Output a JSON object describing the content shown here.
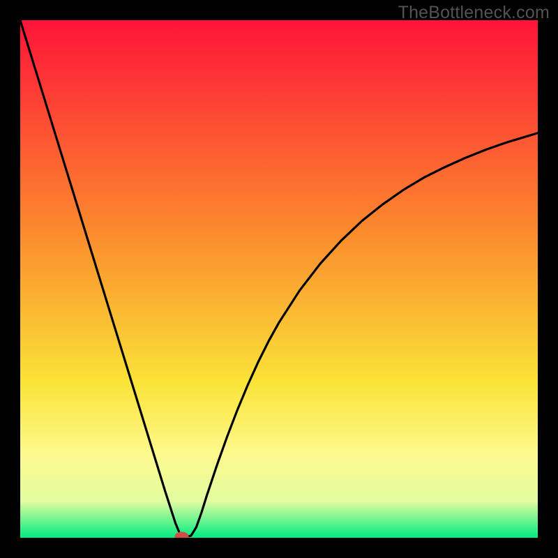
{
  "watermark": "TheBottleneck.com",
  "colors": {
    "frame": "#000000",
    "curve": "#000000",
    "marker_fill": "#d24e46",
    "marker_stroke": "#d24e46",
    "gradient_top": "#fe1438",
    "gradient_mid1": "#fb8e2d",
    "gradient_mid2": "#fae338",
    "gradient_band": "#fdfa8e",
    "gradient_light": "#e1fca0",
    "gradient_bot": "#00ec82"
  },
  "chart_data": {
    "type": "line",
    "title": "",
    "xlabel": "",
    "ylabel": "",
    "xlim": [
      0,
      100
    ],
    "ylim": [
      0,
      100
    ],
    "series": [
      {
        "name": "bottleneck-curve",
        "x": [
          0,
          2,
          4,
          6,
          8,
          10,
          12,
          14,
          16,
          18,
          20,
          22,
          24,
          26,
          28,
          30,
          31,
          32,
          33,
          34,
          35,
          36,
          38,
          40,
          42,
          44,
          46,
          48,
          50,
          54,
          58,
          62,
          66,
          70,
          74,
          78,
          82,
          86,
          90,
          94,
          98,
          100
        ],
        "y": [
          100,
          93.5,
          87,
          80.5,
          74,
          67.5,
          61,
          54.5,
          48,
          41.5,
          35,
          28.5,
          22,
          15.5,
          9,
          2.8,
          0.4,
          0.2,
          0.4,
          2.0,
          4.8,
          8.0,
          14.0,
          19.6,
          24.8,
          29.6,
          34.0,
          38.0,
          41.6,
          47.8,
          53.0,
          57.4,
          61.2,
          64.4,
          67.2,
          69.6,
          71.6,
          73.4,
          75.0,
          76.4,
          77.6,
          78.2
        ]
      }
    ],
    "marker": {
      "x": 31.2,
      "y": 0.2,
      "rx": 1.3,
      "ry": 0.9
    },
    "grid": false,
    "legend": false
  }
}
